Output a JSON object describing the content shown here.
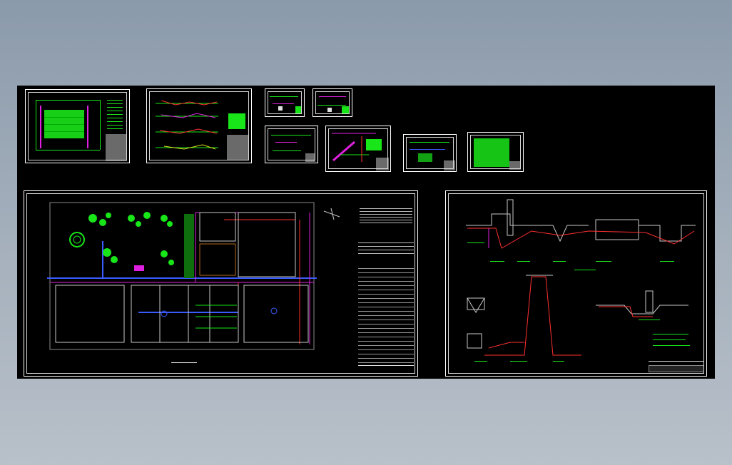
{
  "viewer": {
    "background_color": "#8b9aab",
    "drawing_background": "#000000"
  },
  "sheets": [
    {
      "name": "sheet-1-plan-small",
      "title": ""
    },
    {
      "name": "sheet-2-pipe-profiles",
      "title": ""
    },
    {
      "name": "sheet-3-detail",
      "title": ""
    },
    {
      "name": "sheet-4-detail",
      "title": ""
    },
    {
      "name": "sheet-5-detail",
      "title": ""
    },
    {
      "name": "sheet-6-detail",
      "title": ""
    },
    {
      "name": "sheet-7-detail",
      "title": ""
    },
    {
      "name": "sheet-8-detail",
      "title": ""
    },
    {
      "name": "sheet-9-general-plan",
      "title": ""
    },
    {
      "name": "sheet-10-process-profile",
      "title": ""
    }
  ],
  "colors": {
    "green": "#19e619",
    "red": "#ff3030",
    "magenta": "#e020e0",
    "blue": "#3a5cff",
    "white": "#e0e0e0",
    "title_block": "#6a6a6a"
  }
}
